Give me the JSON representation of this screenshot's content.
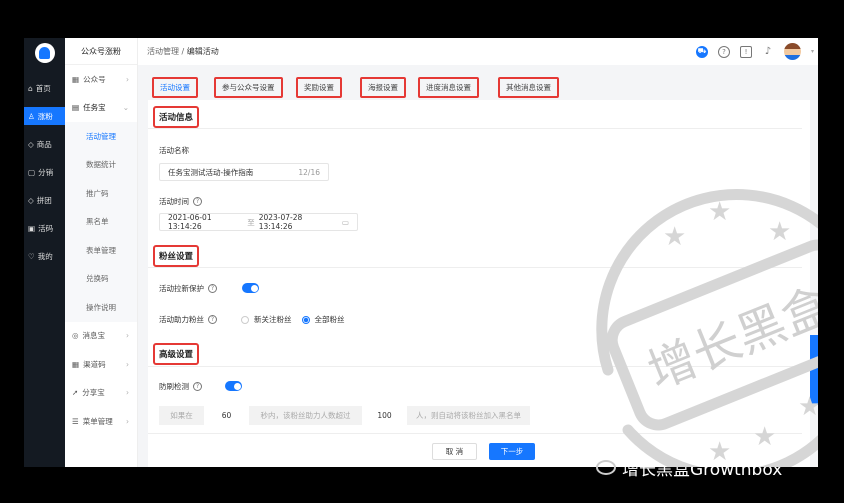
{
  "app": {
    "brand": "公众号涨粉"
  },
  "nav_primary": [
    {
      "label": "首页",
      "icon": "home-icon"
    },
    {
      "label": "涨粉",
      "icon": "user-icon"
    },
    {
      "label": "商品",
      "icon": "tag-icon"
    },
    {
      "label": "分销",
      "icon": "lock-icon"
    },
    {
      "label": "拼团",
      "icon": "tag-icon"
    },
    {
      "label": "活码",
      "icon": "qr-icon"
    },
    {
      "label": "我的",
      "icon": "shield-icon"
    }
  ],
  "nav_secondary": {
    "items": [
      {
        "label": "公众号",
        "icon": "grid-icon"
      },
      {
        "label": "任务宝",
        "icon": "calendar-icon"
      }
    ],
    "sub": [
      "活动管理",
      "数据统计",
      "推广码",
      "黑名单",
      "表单管理",
      "兑换码",
      "操作说明"
    ],
    "more": [
      {
        "label": "消息宝",
        "icon": "message-icon"
      },
      {
        "label": "渠道码",
        "icon": "qr-icon"
      },
      {
        "label": "分享宝",
        "icon": "send-icon"
      },
      {
        "label": "菜单管理",
        "icon": "menu-icon"
      }
    ]
  },
  "breadcrumb": {
    "parent": "活动管理",
    "sep": "/",
    "current": "编辑活动"
  },
  "tabs": [
    "活动设置",
    "参与公众号设置",
    "奖励设置",
    "海报设置",
    "进度消息设置",
    "其他消息设置"
  ],
  "sections": {
    "info": {
      "title": "活动信息",
      "name_label": "活动名称",
      "name_value": "任务宝测试活动-操作指南",
      "name_count": "12/16",
      "time_label": "活动时间",
      "time_start": "2021-06-01 13:14:26",
      "time_sep": "至",
      "time_end": "2023-07-28 13:14:26"
    },
    "fans": {
      "title": "粉丝设置",
      "protect_label": "活动拉新保护",
      "protect_on": true,
      "assist_label": "活动助力粉丝",
      "options": [
        "新关注粉丝",
        "全部粉丝"
      ],
      "selected": "全部粉丝"
    },
    "advanced": {
      "title": "高级设置",
      "anti_label": "防刷检测",
      "anti_on": true,
      "rule": {
        "p1": "如果在",
        "seconds": "60",
        "p2": "秒内，该粉丝助力人数超过",
        "count": "100",
        "p3": "人，则自动将该粉丝加入黑名单"
      }
    }
  },
  "buttons": {
    "cancel": "取 消",
    "next": "下一步"
  },
  "watermark": "增长黑盒",
  "footer": "增长黑盒Growthbox",
  "colors": {
    "accent": "#1677ff",
    "highlight": "#e53935"
  }
}
